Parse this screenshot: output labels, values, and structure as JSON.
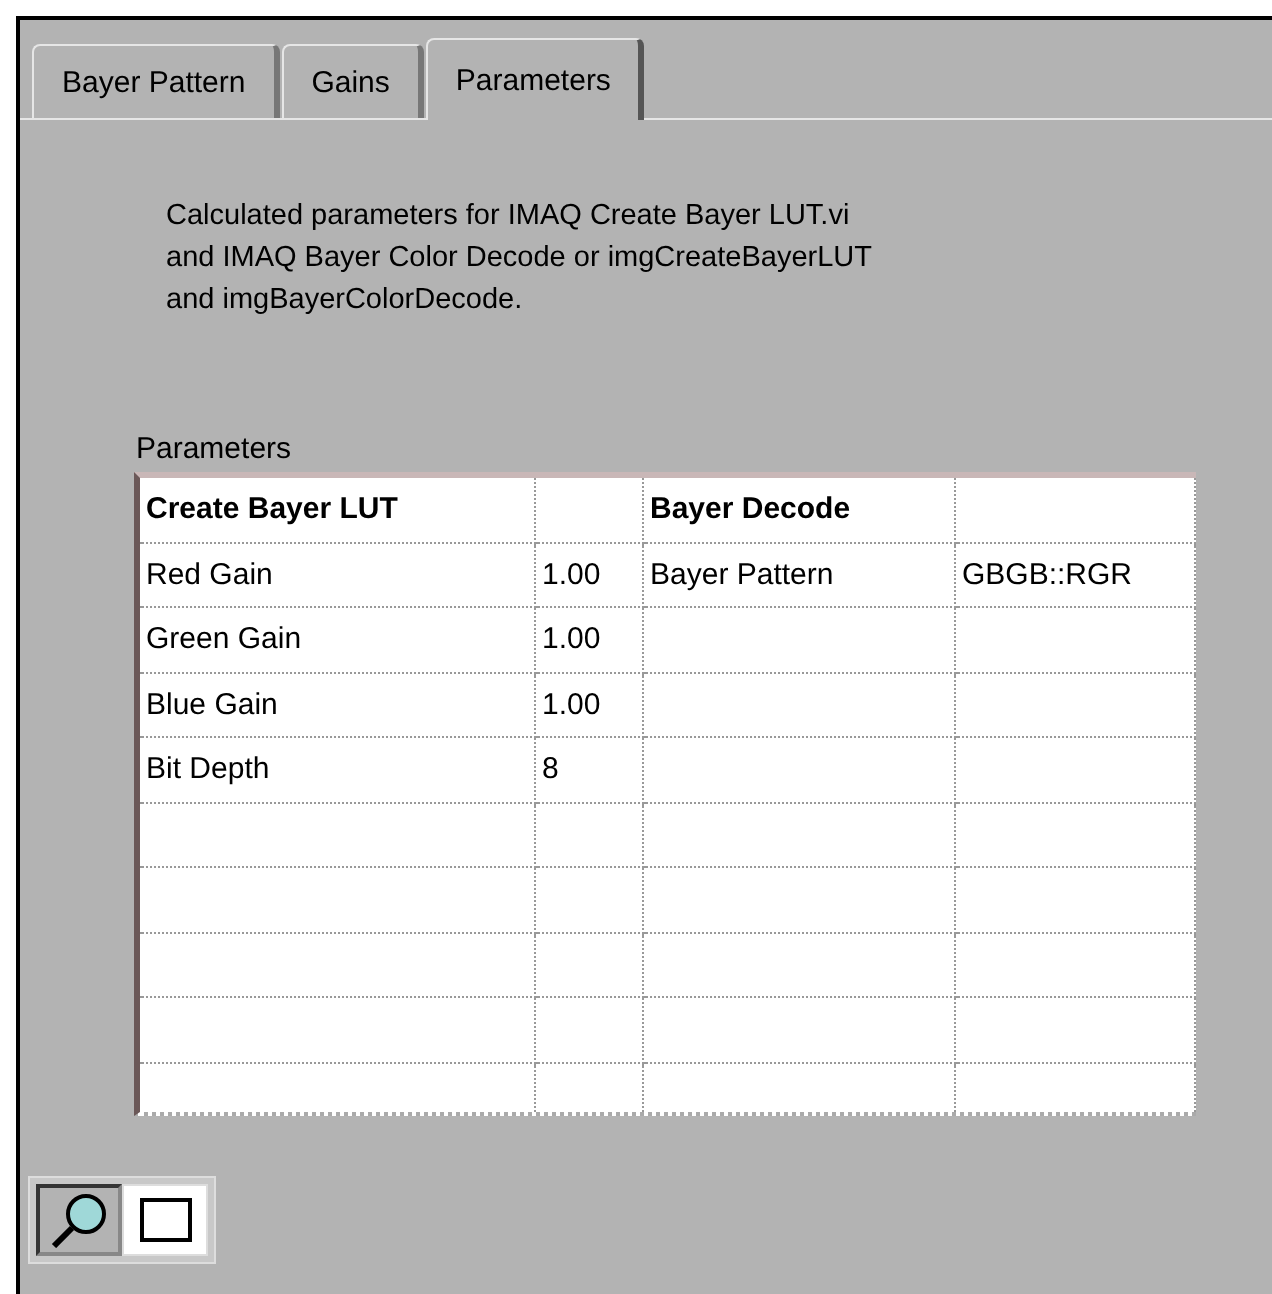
{
  "tabs": [
    {
      "label": "Bayer Pattern",
      "selected": false
    },
    {
      "label": "Gains",
      "selected": false
    },
    {
      "label": "Parameters",
      "selected": true
    }
  ],
  "description": "Calculated parameters for IMAQ Create Bayer LUT.vi and IMAQ Bayer Color Decode or imgCreateBayerLUT and imgBayerColorDecode.",
  "table": {
    "label": "Parameters",
    "sections": [
      {
        "title": "Create Bayer LUT",
        "rows": [
          {
            "name": "Red Gain",
            "value": "1.00"
          },
          {
            "name": "Green Gain",
            "value": "1.00"
          },
          {
            "name": "Blue Gain",
            "value": "1.00"
          },
          {
            "name": "Bit Depth",
            "value": "8"
          }
        ]
      },
      {
        "title": "Bayer Decode",
        "rows": [
          {
            "name": "Bayer Pattern",
            "value": "GBGB::RGR"
          }
        ]
      }
    ]
  },
  "tools": [
    {
      "kind": "zoom",
      "selected": true
    },
    {
      "kind": "select",
      "selected": false
    }
  ]
}
